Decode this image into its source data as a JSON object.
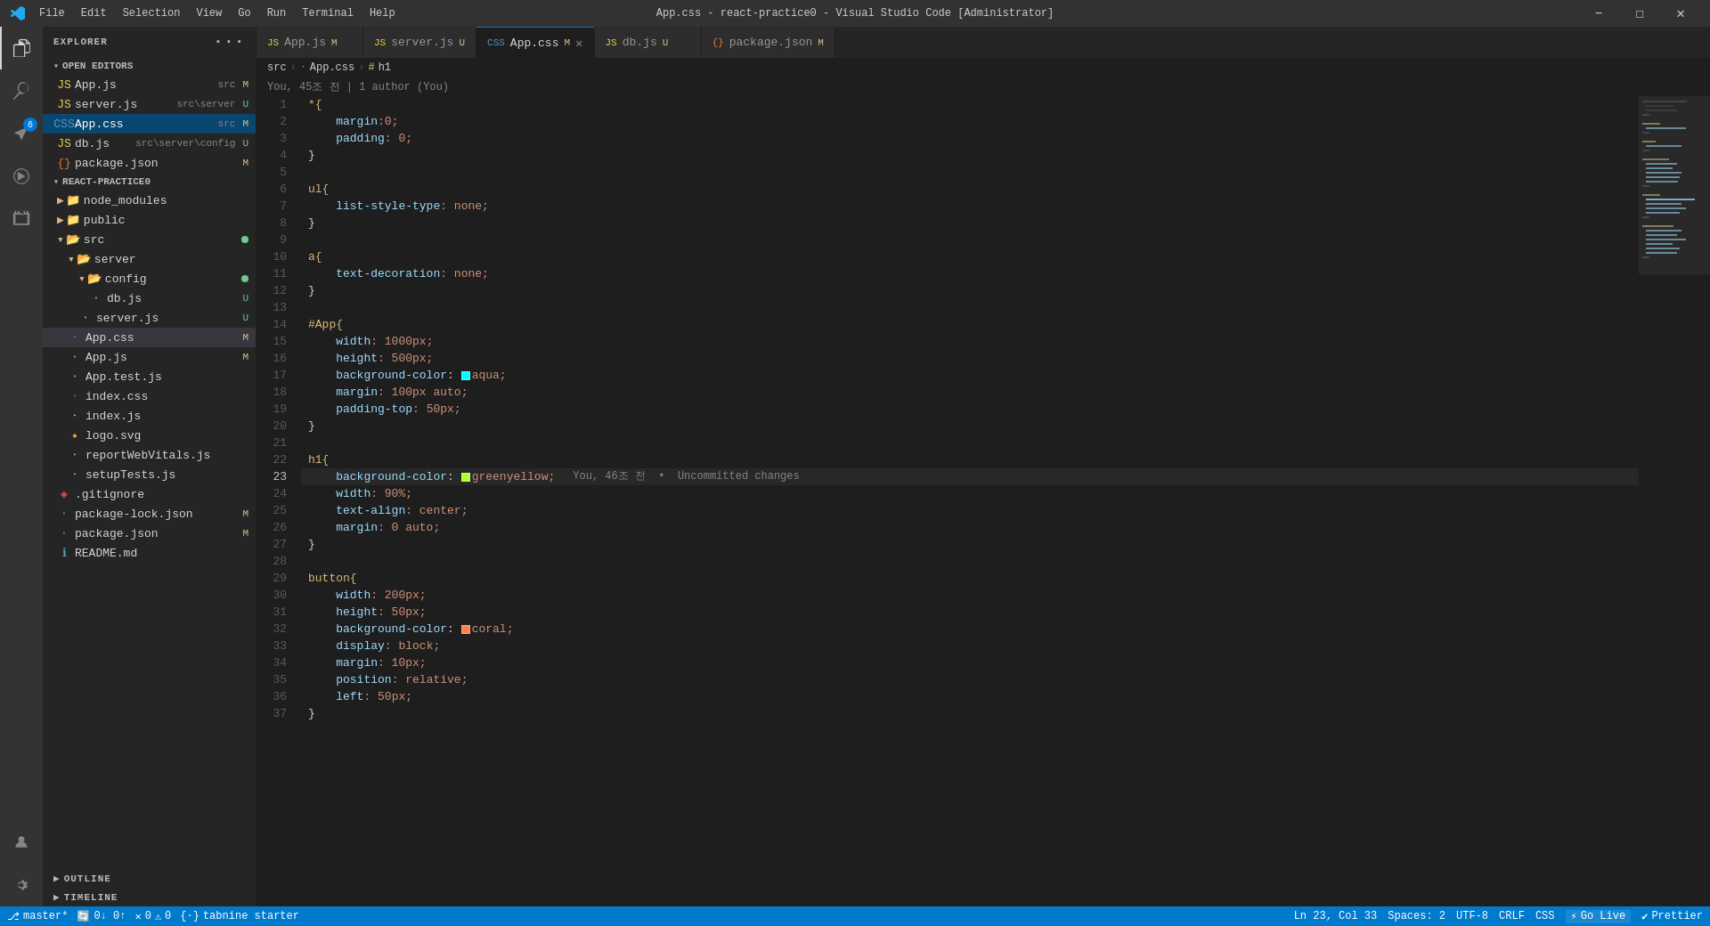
{
  "titlebar": {
    "title": "App.css - react-practice0 - Visual Studio Code [Administrator]",
    "menu_items": [
      "File",
      "Edit",
      "Selection",
      "View",
      "Go",
      "Run",
      "Terminal",
      "Help"
    ],
    "controls": [
      "minimize",
      "maximize",
      "close"
    ]
  },
  "tabs": [
    {
      "id": "app-js",
      "label": "App.js",
      "badge": "M",
      "active": false,
      "closeable": false
    },
    {
      "id": "server-js",
      "label": "server.js",
      "badge": "U",
      "active": false,
      "closeable": false
    },
    {
      "id": "app-css",
      "label": "App.css",
      "badge": "M",
      "active": true,
      "closeable": true
    },
    {
      "id": "db-js",
      "label": "db.js",
      "badge": "U",
      "active": false,
      "closeable": false
    },
    {
      "id": "package-json",
      "label": "package.json",
      "badge": "M",
      "active": false,
      "closeable": false
    }
  ],
  "breadcrumb": {
    "parts": [
      "src",
      "App.css",
      "h1"
    ]
  },
  "blame": "You, 45조 전 | 1 author (You)",
  "sidebar": {
    "title": "EXPLORER",
    "open_editors_label": "OPEN EDITORS",
    "open_editors": [
      {
        "name": "App.js",
        "path": "src",
        "badge": "M",
        "indent": 1,
        "icon": "js"
      },
      {
        "name": "server.js",
        "path": "src\\server",
        "badge": "U",
        "indent": 1,
        "icon": "js"
      },
      {
        "name": "App.css",
        "path": "src",
        "badge": "M",
        "indent": 1,
        "icon": "css",
        "active": true,
        "closeable": true
      },
      {
        "name": "db.js",
        "path": "src\\server\\config",
        "badge": "U",
        "indent": 1,
        "icon": "js"
      },
      {
        "name": "package.json",
        "path": "",
        "badge": "M",
        "indent": 1,
        "icon": "json"
      }
    ],
    "project_label": "REACT-PRACTICE0",
    "tree": [
      {
        "type": "folder",
        "name": "node_modules",
        "indent": 1,
        "collapsed": true
      },
      {
        "type": "folder",
        "name": "public",
        "indent": 1,
        "collapsed": true
      },
      {
        "type": "folder",
        "name": "src",
        "indent": 1,
        "collapsed": false
      },
      {
        "type": "folder",
        "name": "server",
        "indent": 2,
        "collapsed": false
      },
      {
        "type": "folder",
        "name": "config",
        "indent": 3,
        "collapsed": false
      },
      {
        "type": "file",
        "name": "db.js",
        "indent": 4,
        "badge": "U",
        "icon": "js"
      },
      {
        "type": "file",
        "name": "server.js",
        "indent": 3,
        "badge": "U",
        "icon": "js"
      },
      {
        "type": "file",
        "name": "App.css",
        "indent": 2,
        "badge": "M",
        "icon": "css",
        "active": true
      },
      {
        "type": "file",
        "name": "App.js",
        "indent": 2,
        "badge": "M",
        "icon": "js"
      },
      {
        "type": "file",
        "name": "App.test.js",
        "indent": 2,
        "icon": "test"
      },
      {
        "type": "file",
        "name": "index.css",
        "indent": 2,
        "icon": "css"
      },
      {
        "type": "file",
        "name": "index.js",
        "indent": 2,
        "icon": "js"
      },
      {
        "type": "file",
        "name": "logo.svg",
        "indent": 2,
        "icon": "svg"
      },
      {
        "type": "file",
        "name": "reportWebVitals.js",
        "indent": 2,
        "icon": "js"
      },
      {
        "type": "file",
        "name": "setupTests.js",
        "indent": 2,
        "icon": "js"
      },
      {
        "type": "file",
        "name": ".gitignore",
        "indent": 1,
        "icon": "git"
      },
      {
        "type": "file",
        "name": "package-lock.json",
        "indent": 1,
        "badge": "M",
        "icon": "json"
      },
      {
        "type": "file",
        "name": "package.json",
        "indent": 1,
        "badge": "M",
        "icon": "json"
      },
      {
        "type": "file",
        "name": "README.md",
        "indent": 1,
        "icon": "md"
      }
    ],
    "outline_label": "OUTLINE",
    "timeline_label": "TIMELINE"
  },
  "code_lines": [
    {
      "num": 1,
      "code": "*{",
      "type": "selector"
    },
    {
      "num": 2,
      "code": "    margin:0;",
      "type": "property"
    },
    {
      "num": 3,
      "code": "    padding: 0;",
      "type": "property"
    },
    {
      "num": 4,
      "code": "}",
      "type": "punct"
    },
    {
      "num": 5,
      "code": "",
      "type": "empty"
    },
    {
      "num": 6,
      "code": "ul{",
      "type": "selector"
    },
    {
      "num": 7,
      "code": "    list-style-type: none;",
      "type": "property"
    },
    {
      "num": 8,
      "code": "}",
      "type": "punct"
    },
    {
      "num": 9,
      "code": "",
      "type": "empty"
    },
    {
      "num": 10,
      "code": "a{",
      "type": "selector"
    },
    {
      "num": 11,
      "code": "    text-decoration: none;",
      "type": "property"
    },
    {
      "num": 12,
      "code": "}",
      "type": "punct"
    },
    {
      "num": 13,
      "code": "",
      "type": "empty"
    },
    {
      "num": 14,
      "code": "#App{",
      "type": "selector"
    },
    {
      "num": 15,
      "code": "    width: 1000px;",
      "type": "property"
    },
    {
      "num": 16,
      "code": "    height: 500px;",
      "type": "property"
    },
    {
      "num": 17,
      "code": "    background-color: [aqua]aqua;",
      "type": "color-property",
      "color": "aqua"
    },
    {
      "num": 18,
      "code": "    margin: 100px auto;",
      "type": "property"
    },
    {
      "num": 19,
      "code": "    padding-top: 50px;",
      "type": "property"
    },
    {
      "num": 20,
      "code": "}",
      "type": "punct"
    },
    {
      "num": 21,
      "code": "",
      "type": "empty"
    },
    {
      "num": 22,
      "code": "h1{",
      "type": "selector"
    },
    {
      "num": 23,
      "code": "    background-color: [greenyellow]greenyellow;",
      "type": "color-property",
      "color": "greenyellow",
      "active": true,
      "blame": "You, 46조 전  •  Uncommitted changes"
    },
    {
      "num": 24,
      "code": "    width: 90%;",
      "type": "property"
    },
    {
      "num": 25,
      "code": "    text-align: center;",
      "type": "property"
    },
    {
      "num": 26,
      "code": "    margin: 0 auto;",
      "type": "property"
    },
    {
      "num": 27,
      "code": "}",
      "type": "punct"
    },
    {
      "num": 28,
      "code": "",
      "type": "empty"
    },
    {
      "num": 29,
      "code": "button{",
      "type": "selector"
    },
    {
      "num": 30,
      "code": "    width: 200px;",
      "type": "property"
    },
    {
      "num": 31,
      "code": "    height: 50px;",
      "type": "property"
    },
    {
      "num": 32,
      "code": "    background-color: [coral]coral;",
      "type": "color-property",
      "color": "coral"
    },
    {
      "num": 33,
      "code": "    display: block;",
      "type": "property"
    },
    {
      "num": 34,
      "code": "    margin: 10px;",
      "type": "property"
    },
    {
      "num": 35,
      "code": "    position: relative;",
      "type": "property"
    },
    {
      "num": 36,
      "code": "    left: 50px;",
      "type": "property"
    },
    {
      "num": 37,
      "code": "}",
      "type": "punct"
    }
  ],
  "status_bar": {
    "branch": "master*",
    "sync": "0↓ 0↑",
    "errors": "0",
    "warnings": "0",
    "ln_col": "Ln 23, Col 33",
    "spaces": "Spaces: 2",
    "encoding": "UTF-8",
    "line_ending": "CRLF",
    "language": "CSS",
    "go_live": "Go Live",
    "prettier": "Prettier",
    "tabnine": "tabnine starter"
  },
  "activity_icons": {
    "explorer": "📁",
    "search": "🔍",
    "source_control": "⎇",
    "run": "▶",
    "extensions": "⬛",
    "accounts": "👤",
    "settings": "⚙"
  }
}
